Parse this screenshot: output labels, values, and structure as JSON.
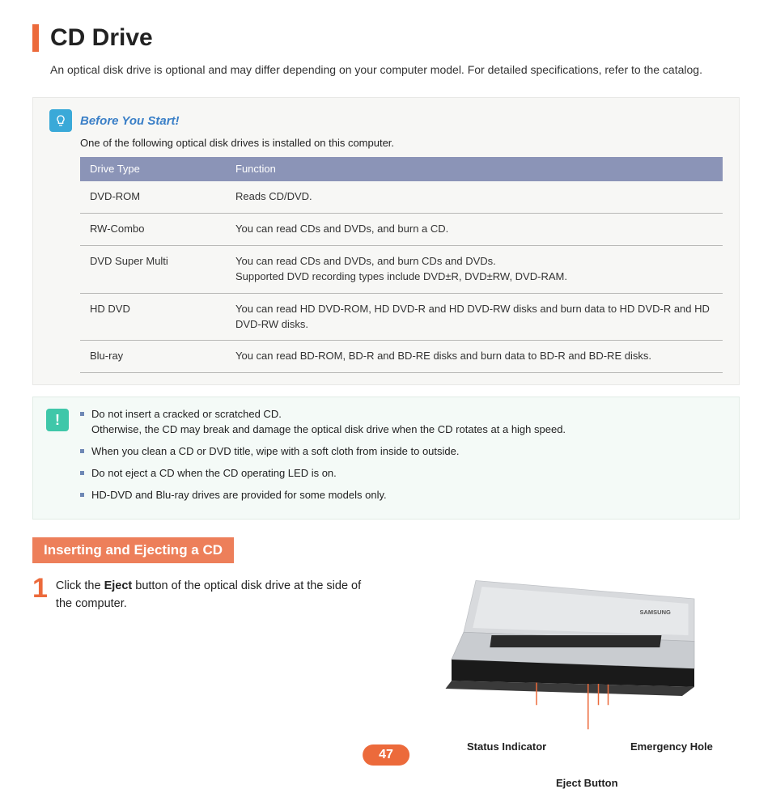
{
  "title": "CD Drive",
  "intro": "An optical disk drive is optional and may differ depending on your computer model. For detailed specifications, refer to the catalog.",
  "tip": {
    "title": "Before You Start!",
    "subtitle": "One of the following optical disk drives is installed on this computer.",
    "headers": {
      "col1": "Drive Type",
      "col2": "Function"
    },
    "rows": [
      {
        "type": "DVD-ROM",
        "func": "Reads CD/DVD."
      },
      {
        "type": "RW-Combo",
        "func": "You can read CDs and DVDs, and burn a CD."
      },
      {
        "type": "DVD Super Multi",
        "func": "You can read CDs and DVDs, and burn CDs and DVDs.\nSupported DVD recording types include DVD±R, DVD±RW, DVD-RAM."
      },
      {
        "type": "HD DVD",
        "func": "You can read HD DVD-ROM, HD DVD-R and HD DVD-RW disks and burn data to HD DVD-R and HD DVD-RW disks."
      },
      {
        "type": "Blu-ray",
        "func": "You can read BD-ROM, BD-R and BD-RE disks and burn data to BD-R and BD-RE disks."
      }
    ]
  },
  "warnings": [
    "Do not insert a cracked or scratched CD.\nOtherwise, the CD may break and damage the optical disk drive when the CD rotates at a high speed.",
    "When you clean a CD or DVD title, wipe with a soft cloth from inside to outside.",
    "Do not eject a CD when the CD operating LED is on.",
    "HD-DVD and Blu-ray drives are provided for some models only."
  ],
  "section": "Inserting and Ejecting a CD",
  "step": {
    "num": "1",
    "pre": "Click the ",
    "bold": "Eject",
    "post": " button of the optical disk drive at the side of the computer."
  },
  "labels": {
    "status": "Status Indicator",
    "eject": "Eject Button",
    "emergency": "Emergency Hole"
  },
  "pagenum": "47",
  "brand": "SAMSUNG"
}
